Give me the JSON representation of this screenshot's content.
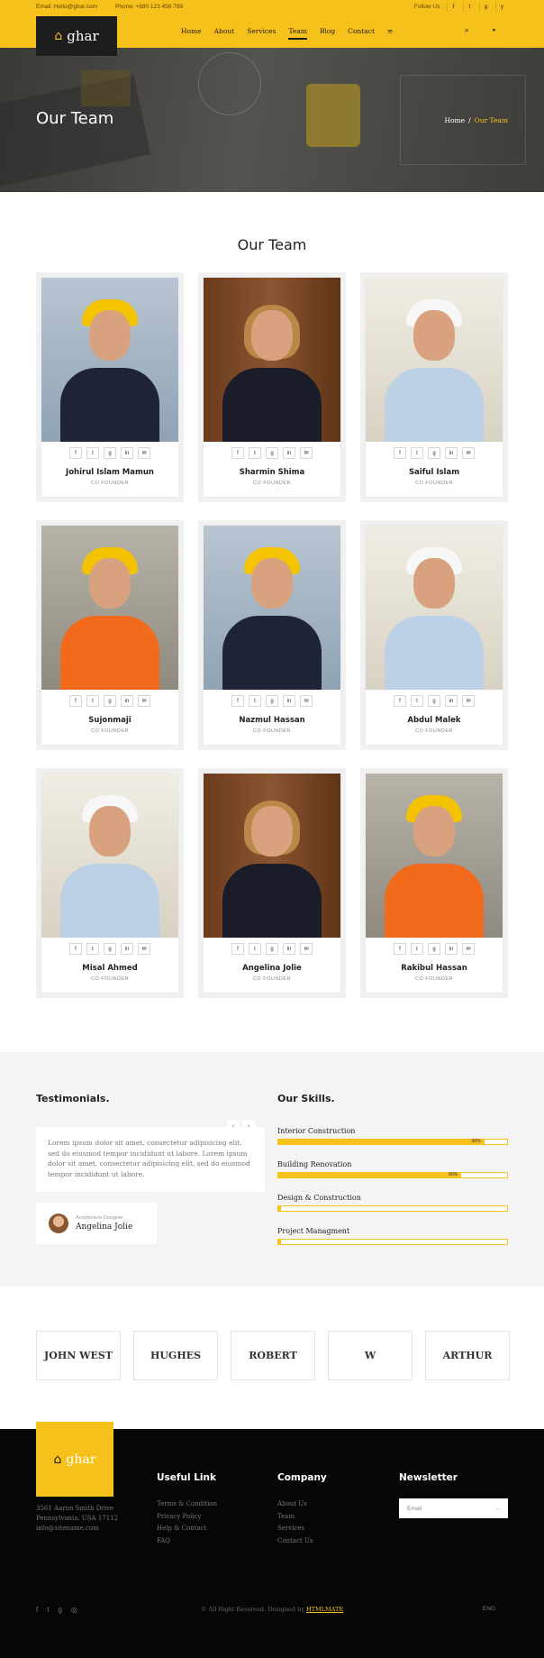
{
  "topbar": {
    "email": "Email: Hello@ghar.com",
    "phone": "Phone: +880 123 456 789",
    "follow_label": "Follow Us :",
    "social": [
      "f",
      "t",
      "g",
      "y"
    ]
  },
  "brand": {
    "logo_mark": "⌂",
    "logo_text": "ghar"
  },
  "nav": {
    "items": [
      "Home",
      "About",
      "Services",
      "Team",
      "Blog",
      "Contact"
    ],
    "active": "Team",
    "menu_icon": "≡",
    "search_icon": "⌕",
    "chat_icon": "▪"
  },
  "hero": {
    "title": "Our Team",
    "breadcrumb_home": "Home",
    "breadcrumb_sep": "/",
    "breadcrumb_current": "Our Team"
  },
  "team": {
    "title": "Our Team",
    "social_icons": [
      "f",
      "t",
      "g",
      "in",
      "✉"
    ],
    "members": [
      {
        "name": "Johirul Islam Mamun",
        "role": "CO FOUNDER",
        "photo": "yellow-man"
      },
      {
        "name": "Sharmin Shima",
        "role": "CO FOUNDER",
        "photo": "woman"
      },
      {
        "name": "Saiful Islam",
        "role": "CO FOUNDER",
        "photo": "white"
      },
      {
        "name": "Sujonmaji",
        "role": "CO FOUNDER",
        "photo": "indus"
      },
      {
        "name": "Nazmul Hassan",
        "role": "CO FOUNDER",
        "photo": "yellow-man"
      },
      {
        "name": "Abdul Malek",
        "role": "CO FOUNDER",
        "photo": "white"
      },
      {
        "name": "Misal Ahmed",
        "role": "CO FOUNDER",
        "photo": "white"
      },
      {
        "name": "Angelina Jolie",
        "role": "CO FOUNDER",
        "photo": "woman"
      },
      {
        "name": "Rakibul Hassan",
        "role": "CO FOUNDER",
        "photo": "indus"
      }
    ]
  },
  "testimonials": {
    "title": "Testimonials.",
    "prev": "‹",
    "next": "›",
    "quote": "Lorem ipsum dolor sit amet, consectetur adipisicing elit, sed do eiusmod tempor incididunt ut labore. Lorem ipsum dolor sit amet, consectetur adipisicing elit, sed do eiusmod tempor incididunt ut labore.",
    "author_role": "Architecture Designer",
    "author_name": "Angelina Jolie"
  },
  "skills": {
    "title": "Our Skills.",
    "items": [
      {
        "label": "Interior Construction",
        "percent": 90,
        "percent_text": "90%"
      },
      {
        "label": "Building Renovation",
        "percent": 80,
        "percent_text": "80%"
      },
      {
        "label": "Design & Construction",
        "percent": 1,
        "percent_text": ""
      },
      {
        "label": "Project Managment",
        "percent": 1,
        "percent_text": ""
      }
    ]
  },
  "clients": [
    "JOHN WEST",
    "HUGHES",
    "ROBERT",
    "W",
    "ARTHUR"
  ],
  "footer": {
    "logo_mark": "⌂",
    "logo_text": "ghar",
    "address": [
      "3561 Aaron Smith Drive",
      "Pennsylvania, USA 17112",
      "info@sitename.com"
    ],
    "useful_title": "Useful Link",
    "useful_links": [
      "Terms & Condition",
      "Privacy Policy",
      "Help & Contact",
      "FAQ"
    ],
    "company_title": "Company",
    "company_links": [
      "About Us",
      "Team",
      "Services",
      "Contact Us"
    ],
    "newsletter_title": "Newsletter",
    "email_placeholder": "Email",
    "send_icon": "→",
    "copyright": "© All Right Reserved. Designed by",
    "designer": "HTMLMATE",
    "social": [
      "f",
      "t",
      "g",
      "◎"
    ],
    "lang": "ENG"
  },
  "colors": {
    "accent": "#f7c11c",
    "dark": "#1d1d1d",
    "footer_bg": "#060606"
  }
}
